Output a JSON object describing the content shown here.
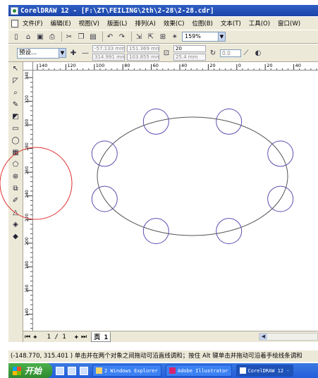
{
  "window": {
    "title": "CorelDRAW 12 - [F:\\ZT\\FEILING\\2th\\2-28\\2-28.cdr]"
  },
  "menu": [
    "文件(F)",
    "编辑(E)",
    "视图(V)",
    "版面(L)",
    "排列(A)",
    "效果(C)",
    "位图(B)",
    "文本(T)",
    "工具(O)",
    "窗口(W)"
  ],
  "standard_toolbar": {
    "zoom": "159%",
    "icons": [
      "new-icon",
      "open-icon",
      "save-icon",
      "print-icon",
      "cut-icon",
      "copy-icon",
      "paste-icon",
      "undo-icon",
      "redo-icon",
      "import-icon",
      "export-icon",
      "app-launcher-icon",
      "corel-online-icon"
    ]
  },
  "property_bar": {
    "preset": "预设...",
    "x": "-57.133 mm",
    "y": "314.991 mm",
    "width": "151.369 mm",
    "height": "103.855 mm",
    "steps": "20",
    "spacing": "25.4 mm",
    "rotation": "0.0"
  },
  "rulers": {
    "unit": "毫米",
    "h_ticks": [
      "140",
      "120",
      "100",
      "80",
      "60",
      "40",
      "20",
      "0",
      "20",
      "40"
    ],
    "v_ticks": [
      "340",
      "320",
      "300",
      "280",
      "260",
      "240",
      "220",
      "200",
      "180",
      "160",
      "140"
    ]
  },
  "page_nav": {
    "counter": "1 / 1",
    "tab": "页 1"
  },
  "status": {
    "text": "(-148.770, 315.401 )  单击并在两个对象之间拖动可沿直线调和；按住 Alt 键单击并拖动可沿着手绘线条调和"
  },
  "taskbar": {
    "start": "开始",
    "tasks": [
      {
        "label": "2 Windows Explorer",
        "active": false
      },
      {
        "label": "Adobe Illustrator",
        "active": false
      },
      {
        "label": "CorelDRAW 12 -",
        "active": true
      }
    ]
  },
  "colors": {
    "circle_stroke": "#5a50b0",
    "ellipse_stroke": "#555555",
    "highlight": "#e03030"
  }
}
